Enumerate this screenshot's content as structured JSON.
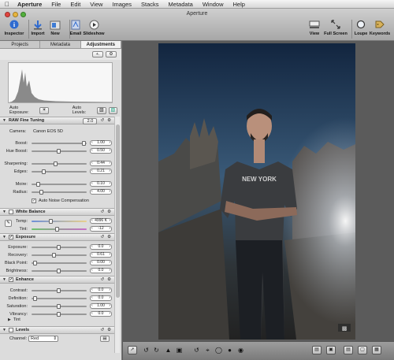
{
  "menubar": {
    "app": "Aperture",
    "items": [
      "File",
      "Edit",
      "View",
      "Images",
      "Stacks",
      "Metadata",
      "Window",
      "Help"
    ]
  },
  "window": {
    "title": "Aperture"
  },
  "toolbar": {
    "inspector": "Inspector",
    "import": "Import",
    "new": "New",
    "email": "Email",
    "slideshow": "Slideshow",
    "view": "View",
    "full_screen": "Full Screen",
    "loupe": "Loupe",
    "keywords": "Keywords"
  },
  "tabs": [
    "Projects",
    "Metadata",
    "Adjustments"
  ],
  "auto": {
    "exposure": "Auto Exposure:",
    "levels": "Auto Levels:"
  },
  "raw": {
    "title": "RAW Fine Tuning",
    "version": "2.0",
    "camera_label": "Camera:",
    "camera": "Canon EOS 5D",
    "boost": {
      "label": "Boost:",
      "value": "1.00"
    },
    "hue_boost": {
      "label": "Hue Boost:",
      "value": "0.50"
    },
    "sharpening": {
      "label": "Sharpening:",
      "value": "0.44"
    },
    "edges": {
      "label": "Edges:",
      "value": "0.21"
    },
    "moire": {
      "label": "Moire:",
      "value": "0.10"
    },
    "radius": {
      "label": "Radius:",
      "value": "4.00"
    },
    "noise": "Auto Noise Compensation"
  },
  "wb": {
    "title": "White Balance",
    "temp": {
      "label": "Temp:",
      "value": "4996 K"
    },
    "tint": {
      "label": "Tint:",
      "value": "-12"
    }
  },
  "exposure": {
    "title": "Exposure",
    "exposure": {
      "label": "Exposure:",
      "value": "0.0"
    },
    "recovery": {
      "label": "Recovery:",
      "value": "0.61"
    },
    "black_point": {
      "label": "Black Point:",
      "value": "0.00"
    },
    "brightness": {
      "label": "Brightness:",
      "value": "0.0"
    }
  },
  "enhance": {
    "title": "Enhance",
    "contrast": {
      "label": "Contrast:",
      "value": "0.0"
    },
    "definition": {
      "label": "Definition:",
      "value": "0.0"
    },
    "saturation": {
      "label": "Saturation:",
      "value": "1.00"
    },
    "vibrancy": {
      "label": "Vibrancy:",
      "value": "0.0"
    },
    "tint": "Tint"
  },
  "levels": {
    "title": "Levels",
    "channel_label": "Channel:",
    "channel": "Red"
  },
  "photo": {
    "shirt_text": "NEW YORK"
  }
}
